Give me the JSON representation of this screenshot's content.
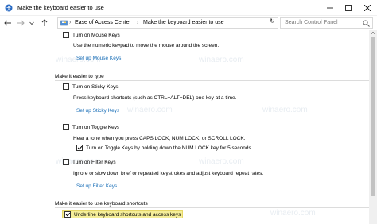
{
  "window": {
    "title": "Make the keyboard easier to use"
  },
  "breadcrumb": {
    "items": [
      "Ease of Access Center",
      "Make the keyboard easier to use"
    ]
  },
  "search": {
    "placeholder": "Search Control Panel"
  },
  "mouse_keys": {
    "checkbox_label": "Turn on Mouse Keys",
    "checked": false,
    "description": "Use the numeric keypad to move the mouse around the screen.",
    "link": "Set up Mouse Keys"
  },
  "typing_section": {
    "heading": "Make it easier to type",
    "sticky_keys": {
      "checkbox_label": "Turn on Sticky Keys",
      "checked": false,
      "description": "Press keyboard shortcuts (such as CTRL+ALT+DEL) one key at a time.",
      "link": "Set up Sticky Keys"
    },
    "toggle_keys": {
      "checkbox_label": "Turn on Toggle Keys",
      "checked": false,
      "description": "Hear a tone when you press CAPS LOCK, NUM LOCK, or SCROLL LOCK.",
      "sub_checkbox_label": "Turn on Toggle Keys by holding down the NUM LOCK key for 5 seconds",
      "sub_checked": true
    },
    "filter_keys": {
      "checkbox_label": "Turn on Filter Keys",
      "checked": false,
      "description": "Ignore or slow down brief or repeated keystrokes and adjust keyboard repeat rates.",
      "link": "Set up Filter Keys"
    }
  },
  "shortcuts_section": {
    "heading": "Make it easier to use keyboard shortcuts",
    "underline": {
      "checkbox_label": "Underline keyboard shortcuts and access keys",
      "checked": true
    }
  },
  "watermark": "winaero.com",
  "colors": {
    "link": "#1a6fb8",
    "highlight": "#f5ee99"
  },
  "icons": [
    "ease-of-access-icon",
    "minimize-icon",
    "maximize-icon",
    "close-icon",
    "back-arrow-icon",
    "forward-arrow-icon",
    "recent-dropdown-icon",
    "up-arrow-icon",
    "control-panel-icon",
    "chevron-down-icon",
    "refresh-icon",
    "search-icon"
  ]
}
